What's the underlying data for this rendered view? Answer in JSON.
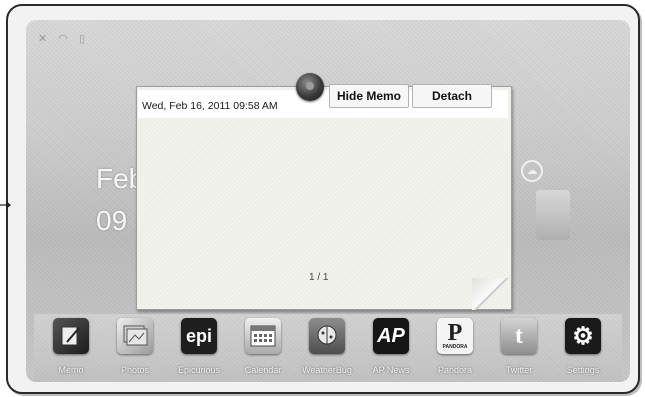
{
  "status_bar": {
    "icons": [
      "x-icon",
      "wifi-icon",
      "sd-card-icon"
    ]
  },
  "background": {
    "date_partial": "Feb",
    "time_partial": "09"
  },
  "memo": {
    "timestamp": "Wed, Feb 16, 2011 09:58 AM",
    "hide_label": "Hide Memo",
    "detach_label": "Detach",
    "page_indicator": "1 / 1"
  },
  "dock": {
    "apps": [
      {
        "label": "Memo",
        "icon": "memo-icon"
      },
      {
        "label": "Photos",
        "icon": "photos-icon"
      },
      {
        "label": "Epicurious",
        "icon": "epicurious-icon",
        "glyph": "epi"
      },
      {
        "label": "Calendar",
        "icon": "calendar-icon"
      },
      {
        "label": "WeatherBug",
        "icon": "weatherbug-icon"
      },
      {
        "label": "AP News",
        "icon": "ap-news-icon",
        "glyph": "AP"
      },
      {
        "label": "Pandora",
        "icon": "pandora-icon",
        "glyph": "P",
        "sub": "PANDORA"
      },
      {
        "label": "Twitter",
        "icon": "twitter-icon",
        "glyph": "t"
      },
      {
        "label": "Settings",
        "icon": "settings-icon",
        "glyph": "⚙"
      }
    ]
  }
}
